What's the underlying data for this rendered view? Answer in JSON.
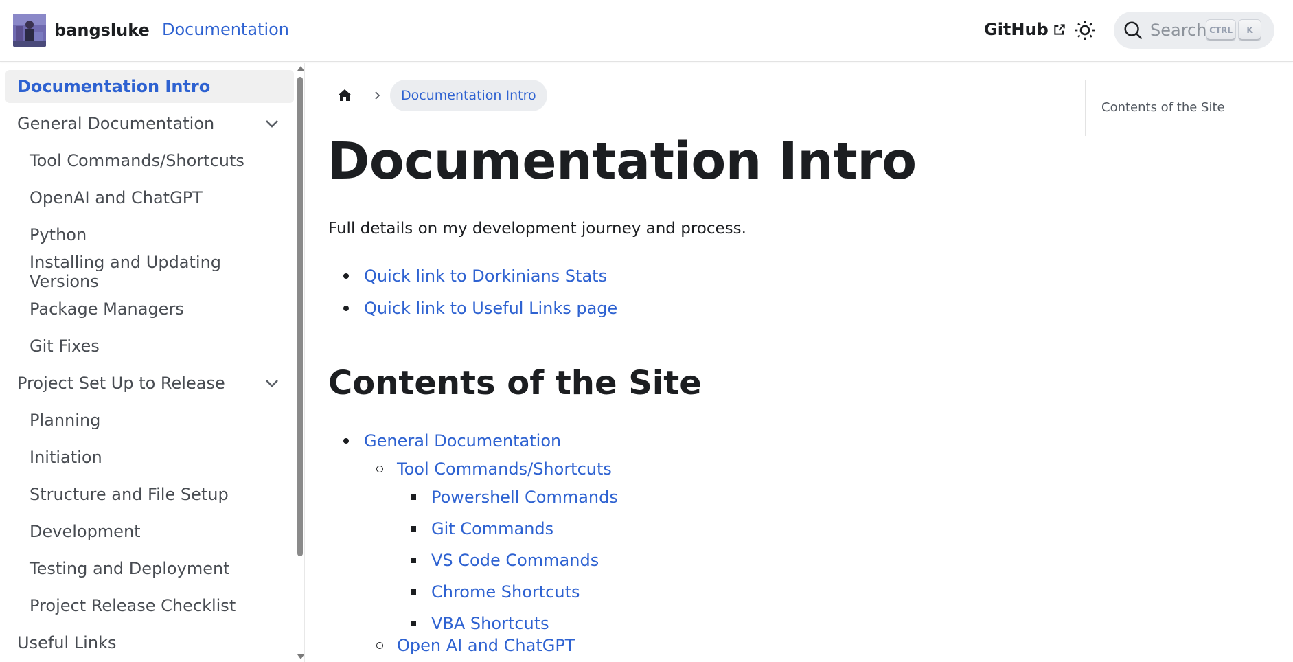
{
  "navbar": {
    "brand": "bangsluke",
    "docs_link": "Documentation",
    "github_link": "GitHub",
    "search_placeholder": "Search",
    "key_ctrl": "CTRL",
    "key_k": "K"
  },
  "sidebar": {
    "items": [
      {
        "label": "Documentation Intro",
        "level": 1,
        "active": true
      },
      {
        "label": "General Documentation",
        "level": 1,
        "collapsible": true
      },
      {
        "label": "Tool Commands/Shortcuts",
        "level": 2
      },
      {
        "label": "OpenAI and ChatGPT",
        "level": 2
      },
      {
        "label": "Python",
        "level": 2
      },
      {
        "label": "Installing and Updating Versions",
        "level": 2
      },
      {
        "label": "Package Managers",
        "level": 2
      },
      {
        "label": "Git Fixes",
        "level": 2
      },
      {
        "label": "Project Set Up to Release",
        "level": 1,
        "collapsible": true
      },
      {
        "label": "Planning",
        "level": 2
      },
      {
        "label": "Initiation",
        "level": 2
      },
      {
        "label": "Structure and File Setup",
        "level": 2
      },
      {
        "label": "Development",
        "level": 2
      },
      {
        "label": "Testing and Deployment",
        "level": 2
      },
      {
        "label": "Project Release Checklist",
        "level": 2
      },
      {
        "label": "Useful Links",
        "level": 1
      }
    ]
  },
  "breadcrumb": {
    "current": "Documentation Intro"
  },
  "main": {
    "title": "Documentation Intro",
    "intro": "Full details on my development journey and process.",
    "quick_links": [
      "Quick link to Dorkinians Stats",
      "Quick link to Useful Links page"
    ],
    "section_title": "Contents of the Site",
    "contents": {
      "general_documentation": "General Documentation",
      "tool_commands": "Tool Commands/Shortcuts",
      "tool_items": [
        "Powershell Commands",
        "Git Commands",
        "VS Code Commands",
        "Chrome Shortcuts",
        "VBA Shortcuts"
      ],
      "open_ai": "Open AI and ChatGPT"
    }
  },
  "toc": {
    "items": [
      "Contents of the Site"
    ]
  },
  "colors": {
    "accent": "#2e62d1",
    "text": "#1c1e21",
    "sidebar_text": "#484c52",
    "active_bg": "#f0f0f0",
    "search_bg": "#ebedf0"
  }
}
